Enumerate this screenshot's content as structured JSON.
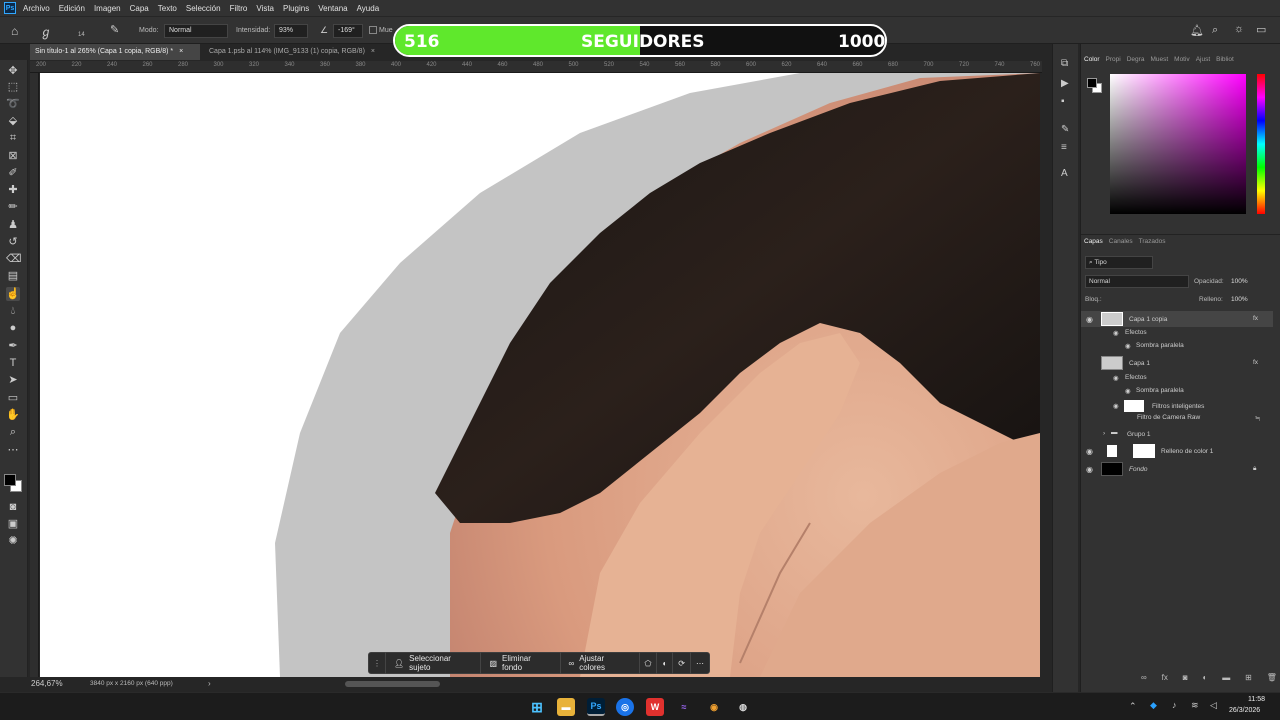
{
  "menu": {
    "items": [
      "Archivo",
      "Edición",
      "Imagen",
      "Capa",
      "Texto",
      "Selección",
      "Filtro",
      "Vista",
      "Plugins",
      "Ventana",
      "Ayuda"
    ]
  },
  "options": {
    "brush_size": "14",
    "mode_label": "Modo:",
    "mode_value": "Normal",
    "intensity_label": "Intensidad:",
    "intensity_value": "93%",
    "angle_value": "-169°",
    "sample_label": "Mue"
  },
  "overlay": {
    "current": "516",
    "label": "SEGUIDORES",
    "goal": "1000",
    "progress": 0.5,
    "fill_color": "#5fe82c"
  },
  "tabs": [
    {
      "label": "Sin título-1 al 265% (Capa 1 copia, RGB/8) *",
      "active": true
    },
    {
      "label": "Capa 1.psb al 114% (IMG_9133 (1) copia, RGB/8)",
      "active": false
    }
  ],
  "ruler": {
    "ticks": [
      "200",
      "220",
      "240",
      "260",
      "280",
      "300",
      "320",
      "340",
      "360",
      "380",
      "400",
      "420",
      "440",
      "460",
      "480",
      "500",
      "520",
      "540",
      "560",
      "580",
      "600",
      "620",
      "640",
      "660",
      "680",
      "700",
      "720",
      "740",
      "760"
    ]
  },
  "status": {
    "zoom": "264,67%",
    "doc_size": "3840 px x 2160 px (640 ppp)"
  },
  "context_bar": {
    "select_subject": "Seleccionar sujeto",
    "remove_bg": "Eliminar fondo",
    "adjust_colors": "Ajustar colores"
  },
  "panels": {
    "color_tabs": [
      "Color",
      "Propi",
      "Degra",
      "Muest",
      "Motiv",
      "Ajust",
      "Bibliot"
    ],
    "layer_tabs": [
      "Capas",
      "Canales",
      "Trazados"
    ],
    "filter_kind": "Tipo",
    "blend_mode": "Normal",
    "opacity_label": "Opacidad:",
    "opacity_value": "100%",
    "lock_label": "Bloq.:",
    "fill_label": "Relleno:",
    "fill_value": "100%",
    "layers": [
      {
        "name": "Capa 1 copia",
        "visible": true,
        "selected": true,
        "fx": true
      },
      {
        "name": "Efectos",
        "sub": true
      },
      {
        "name": "Sombra paralela",
        "sub": true
      },
      {
        "name": "Capa 1",
        "visible": false,
        "fx": true
      },
      {
        "name": "Efectos",
        "sub": true
      },
      {
        "name": "Sombra paralela",
        "sub": true
      },
      {
        "name": "Filtros inteligentes",
        "sub": true
      },
      {
        "name": "Filtro de Camera Raw",
        "sub": true
      },
      {
        "name": "Grupo 1",
        "visible": false
      },
      {
        "name": "Relleno de color 1",
        "visible": true
      },
      {
        "name": "Fondo",
        "visible": true,
        "locked": true
      }
    ]
  },
  "taskbar": {
    "time": "11:58",
    "date": "26/3/2026"
  },
  "colors": {
    "accent": "#31a8ff",
    "panel_bg": "#323232",
    "app_bg": "#262626"
  }
}
